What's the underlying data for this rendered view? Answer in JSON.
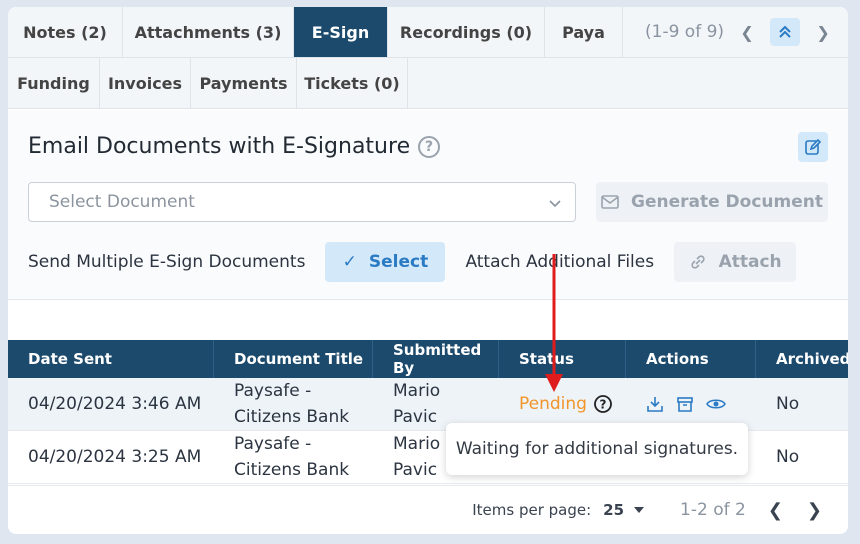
{
  "tabs_row1": [
    "Notes (2)",
    "Attachments (3)",
    "E-Sign",
    "Recordings (0)",
    "Paya"
  ],
  "tabs_row1_active": "E-Sign",
  "tabs_pager": "(1-9 of 9)",
  "tabs_row2": [
    "Funding",
    "Invoices",
    "Payments",
    "Tickets (0)"
  ],
  "esign": {
    "title": "Email Documents with E-Signature",
    "select_placeholder": "Select Document",
    "generate_label": "Generate Document",
    "multi_label": "Send Multiple E-Sign Documents",
    "select_label": "Select",
    "attach_files_label": "Attach Additional Files",
    "attach_label": "Attach"
  },
  "table": {
    "headers": [
      "Date Sent",
      "Document Title",
      "Submitted By",
      "Status",
      "Actions",
      "Archived"
    ],
    "rows": [
      {
        "date": "04/20/2024 3:46 AM",
        "title1": "Paysafe -",
        "title2": "Citizens Bank",
        "by1": "Mario",
        "by2": "Pavic",
        "status": "Pending",
        "archived": "No"
      },
      {
        "date": "04/20/2024 3:25 AM",
        "title1": "Paysafe -",
        "title2": "Citizens Bank",
        "by1": "Mario",
        "by2": "Pavic",
        "status": "",
        "archived": "No"
      }
    ]
  },
  "tooltip": "Waiting for additional signatures.",
  "footer": {
    "items_per_page_label": "Items per page:",
    "items_per_page_value": "25",
    "range": "1-2 of 2"
  },
  "colors": {
    "primary": "#1c4a6c",
    "accent": "#2b7bc4",
    "pending": "#f0952a",
    "arrow": "#e01b1b"
  }
}
